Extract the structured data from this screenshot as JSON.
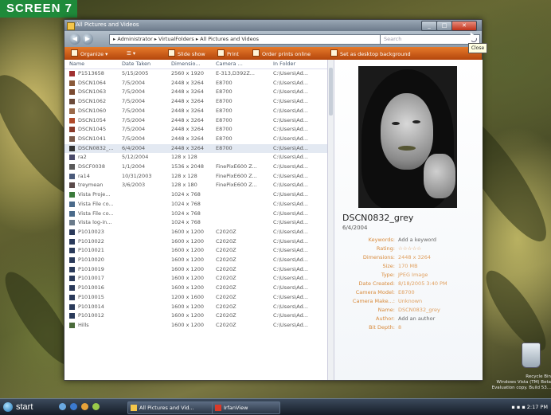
{
  "screen_label": "SCREEN 7",
  "window": {
    "title": "All Pictures and Videos",
    "close_tooltip": "Close",
    "address": "▸ Administrator ▸ VirtualFolders ▸ All Pictures and Videos",
    "search_placeholder": "Search"
  },
  "toolbar": {
    "organize": "Organize ▾",
    "views": "☰ ▾",
    "slideshow": "Slide show",
    "print": "Print",
    "order_prints": "Order prints online",
    "desktop_bg": "Set as desktop background"
  },
  "columns": [
    "Name",
    "Date Taken",
    "Dimensio...",
    "Camera ...",
    "In Folder"
  ],
  "rows": [
    {
      "name": "P1513658",
      "date": "5/15/2005",
      "dim": "2560 x 1920",
      "cam": "E-313,D392Z...",
      "folder": "C:\\Users\\Ad...",
      "color": "#a03030"
    },
    {
      "name": "DSCN1064",
      "date": "7/5/2004",
      "dim": "2448 x 3264",
      "cam": "E8700",
      "folder": "C:\\Users\\Ad...",
      "color": "#8a5a3a"
    },
    {
      "name": "DSCN1063",
      "date": "7/5/2004",
      "dim": "2448 x 3264",
      "cam": "E8700",
      "folder": "C:\\Users\\Ad...",
      "color": "#7a4a30"
    },
    {
      "name": "DSCN1062",
      "date": "7/5/2004",
      "dim": "2448 x 3264",
      "cam": "E8700",
      "folder": "C:\\Users\\Ad...",
      "color": "#6a4a3a"
    },
    {
      "name": "DSCN1060",
      "date": "7/5/2004",
      "dim": "2448 x 3264",
      "cam": "E8700",
      "folder": "C:\\Users\\Ad...",
      "color": "#9a6a4a"
    },
    {
      "name": "DSCN1054",
      "date": "7/5/2004",
      "dim": "2448 x 3264",
      "cam": "E8700",
      "folder": "C:\\Users\\Ad...",
      "color": "#b04a2a"
    },
    {
      "name": "DSCN1045",
      "date": "7/5/2004",
      "dim": "2448 x 3264",
      "cam": "E8700",
      "folder": "C:\\Users\\Ad...",
      "color": "#8a3a2a"
    },
    {
      "name": "DSCN1041",
      "date": "7/5/2004",
      "dim": "2448 x 3264",
      "cam": "E8700",
      "folder": "C:\\Users\\Ad...",
      "color": "#7a5a4a"
    },
    {
      "name": "DSCN0832_...",
      "date": "6/4/2004",
      "dim": "2448 x 3264",
      "cam": "E8700",
      "folder": "C:\\Users\\Ad...",
      "color": "#333333",
      "selected": true
    },
    {
      "name": "ra2",
      "date": "5/12/2004",
      "dim": "128 x 128",
      "cam": "",
      "folder": "C:\\Users\\Ad...",
      "color": "#4a4a6a"
    },
    {
      "name": "DSCF0038",
      "date": "1/1/2004",
      "dim": "1536 x 2048",
      "cam": "FinePixE600 Z...",
      "folder": "C:\\Users\\Ad...",
      "color": "#5a5a5a"
    },
    {
      "name": "ra14",
      "date": "10/31/2003",
      "dim": "128 x 128",
      "cam": "FinePixE600 Z...",
      "folder": "C:\\Users\\Ad...",
      "color": "#4a5a7a"
    },
    {
      "name": "treymean",
      "date": "3/6/2003",
      "dim": "128 x 180",
      "cam": "FinePixE600 Z...",
      "folder": "C:\\Users\\Ad...",
      "color": "#5a4a4a"
    },
    {
      "name": "Vista Proje...",
      "date": "",
      "dim": "1024 x 768",
      "cam": "",
      "folder": "C:\\Users\\Ad...",
      "color": "#3a7a3a"
    },
    {
      "name": "Vista File co...",
      "date": "",
      "dim": "1024 x 768",
      "cam": "",
      "folder": "C:\\Users\\Ad...",
      "color": "#4a6a8a"
    },
    {
      "name": "Vista File co...",
      "date": "",
      "dim": "1024 x 768",
      "cam": "",
      "folder": "C:\\Users\\Ad...",
      "color": "#4a6a8a"
    },
    {
      "name": "Vista log-in...",
      "date": "",
      "dim": "1024 x 768",
      "cam": "",
      "folder": "C:\\Users\\Ad...",
      "color": "#6a7a8a"
    },
    {
      "name": "P1010023",
      "date": "",
      "dim": "1600 x 1200",
      "cam": "C2020Z",
      "folder": "C:\\Users\\Ad...",
      "color": "#2a3a5a"
    },
    {
      "name": "P1010022",
      "date": "",
      "dim": "1600 x 1200",
      "cam": "C2020Z",
      "folder": "C:\\Users\\Ad...",
      "color": "#2a3a5a"
    },
    {
      "name": "P1010021",
      "date": "",
      "dim": "1600 x 1200",
      "cam": "C2020Z",
      "folder": "C:\\Users\\Ad...",
      "color": "#2a3a5a"
    },
    {
      "name": "P1010020",
      "date": "",
      "dim": "1600 x 1200",
      "cam": "C2020Z",
      "folder": "C:\\Users\\Ad...",
      "color": "#2a3a5a"
    },
    {
      "name": "P1010019",
      "date": "",
      "dim": "1600 x 1200",
      "cam": "C2020Z",
      "folder": "C:\\Users\\Ad...",
      "color": "#2a3a5a"
    },
    {
      "name": "P1010017",
      "date": "",
      "dim": "1600 x 1200",
      "cam": "C2020Z",
      "folder": "C:\\Users\\Ad...",
      "color": "#2a3a5a"
    },
    {
      "name": "P1010016",
      "date": "",
      "dim": "1600 x 1200",
      "cam": "C2020Z",
      "folder": "C:\\Users\\Ad...",
      "color": "#2a3a5a"
    },
    {
      "name": "P1010015",
      "date": "",
      "dim": "1200 x 1600",
      "cam": "C2020Z",
      "folder": "C:\\Users\\Ad...",
      "color": "#2a3a5a"
    },
    {
      "name": "P1010014",
      "date": "",
      "dim": "1600 x 1200",
      "cam": "C2020Z",
      "folder": "C:\\Users\\Ad...",
      "color": "#2a3a5a"
    },
    {
      "name": "P1010012",
      "date": "",
      "dim": "1600 x 1200",
      "cam": "C2020Z",
      "folder": "C:\\Users\\Ad...",
      "color": "#2a3a5a"
    },
    {
      "name": "Hills",
      "date": "",
      "dim": "1600 x 1200",
      "cam": "C2020Z",
      "folder": "C:\\Users\\Ad...",
      "color": "#4a6a3a"
    }
  ],
  "preview": {
    "name": "DSCN0832_grey",
    "date": "6/4/2004",
    "properties": [
      {
        "k": "Keywords:",
        "v": "Add a keyword",
        "link": false
      },
      {
        "k": "Rating:",
        "v": "☆☆☆☆☆",
        "link": true
      },
      {
        "k": "Dimensions:",
        "v": "2448 x 3264",
        "link": true
      },
      {
        "k": "Size:",
        "v": "170 MB",
        "link": true
      },
      {
        "k": "Type:",
        "v": "JPEG Image",
        "link": true
      },
      {
        "k": "Date Created:",
        "v": "8/18/2005 3:40 PM",
        "link": true
      },
      {
        "k": "Camera Model:",
        "v": "E8700",
        "link": true
      },
      {
        "k": "Camera Make...:",
        "v": "Unknown",
        "link": true
      },
      {
        "k": "Name:",
        "v": "DSCN0832_grey",
        "link": true
      },
      {
        "k": "Author:",
        "v": "Add an author",
        "link": false
      },
      {
        "k": "Bit Depth:",
        "v": "8",
        "link": true
      }
    ]
  },
  "desktop": {
    "recycle_bin": "Recycle Bin",
    "info_line1": "Windows Vista (TM) Beta",
    "info_line2": "Evaluation copy. Build 53..."
  },
  "taskbar": {
    "start": "start",
    "task1": "All Pictures and Vid...",
    "task2": "IrfanView",
    "clock": "2:17 PM"
  }
}
